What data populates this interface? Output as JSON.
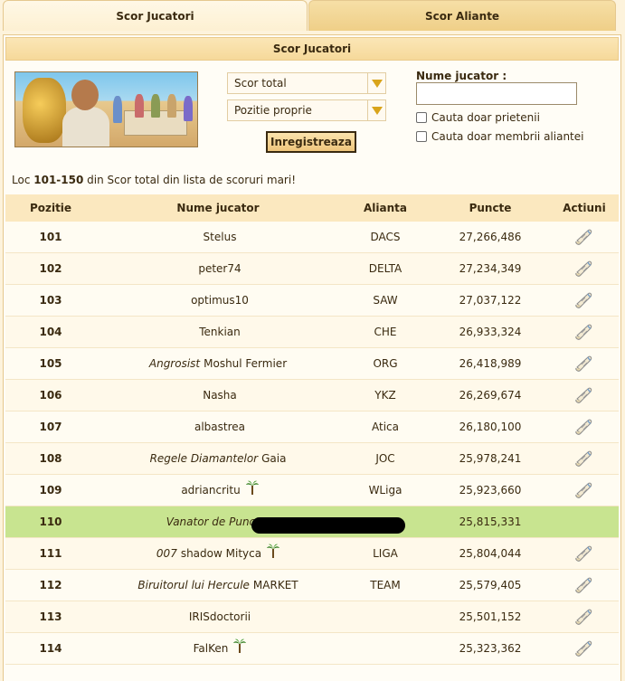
{
  "tabs": {
    "players": "Scor Jucatori",
    "alliances": "Scor Aliante"
  },
  "panel": {
    "title": "Scor Jucatori"
  },
  "filters": {
    "score_type": "Scor total",
    "position": "Pozitie proprie",
    "register_button": "Inregistreaza",
    "name_label": "Nume jucator :",
    "name_value": "",
    "only_friends": "Cauta doar prietenii",
    "only_alliance": "Cauta doar membrii aliantei"
  },
  "summary": {
    "prefix": "Loc",
    "range": "101-150",
    "suffix": "din Scor total din lista de scoruri mari!"
  },
  "table": {
    "headers": {
      "position": "Pozitie",
      "name": "Nume jucator",
      "alliance": "Alianta",
      "points": "Puncte",
      "actions": "Actiuni"
    },
    "rows": [
      {
        "pos": "101",
        "title": "",
        "name": "Stelus",
        "alliance": "DACS",
        "points": "27,266,486"
      },
      {
        "pos": "102",
        "title": "",
        "name": "peter74",
        "alliance": "DELTA",
        "points": "27,234,349"
      },
      {
        "pos": "103",
        "title": "",
        "name": "optimus10",
        "alliance": "SAW",
        "points": "27,037,122"
      },
      {
        "pos": "104",
        "title": "",
        "name": "Tenkian",
        "alliance": "CHE",
        "points": "26,933,324"
      },
      {
        "pos": "105",
        "title": "Angrosist",
        "name": "Moshul Fermier",
        "alliance": "ORG",
        "points": "26,418,989"
      },
      {
        "pos": "106",
        "title": "",
        "name": "Nasha",
        "alliance": "YKZ",
        "points": "26,269,674"
      },
      {
        "pos": "107",
        "title": "",
        "name": "albastrea",
        "alliance": "Atica",
        "points": "26,180,100"
      },
      {
        "pos": "108",
        "title": "Regele Diamantelor",
        "name": "Gaia",
        "alliance": "JOC",
        "points": "25,978,241"
      },
      {
        "pos": "109",
        "title": "",
        "name": "adriancritu",
        "alliance": "WLiga",
        "points": "25,923,660"
      },
      {
        "pos": "110",
        "title": "Vanator de Puncte",
        "name": "",
        "alliance": "",
        "points": "25,815,331"
      },
      {
        "pos": "111",
        "title": "007",
        "name": "shadow Mityca",
        "alliance": "LIGA",
        "points": "25,804,044"
      },
      {
        "pos": "112",
        "title": "Biruitorul lui Hercule",
        "name": "MARKET",
        "alliance": "TEAM",
        "points": "25,579,405"
      },
      {
        "pos": "113",
        "title": "",
        "name": "IRISdoctorii",
        "alliance": "",
        "points": "25,501,152"
      },
      {
        "pos": "114",
        "title": "",
        "name": "FalKen",
        "alliance": "",
        "points": "25,323,362"
      }
    ]
  }
}
